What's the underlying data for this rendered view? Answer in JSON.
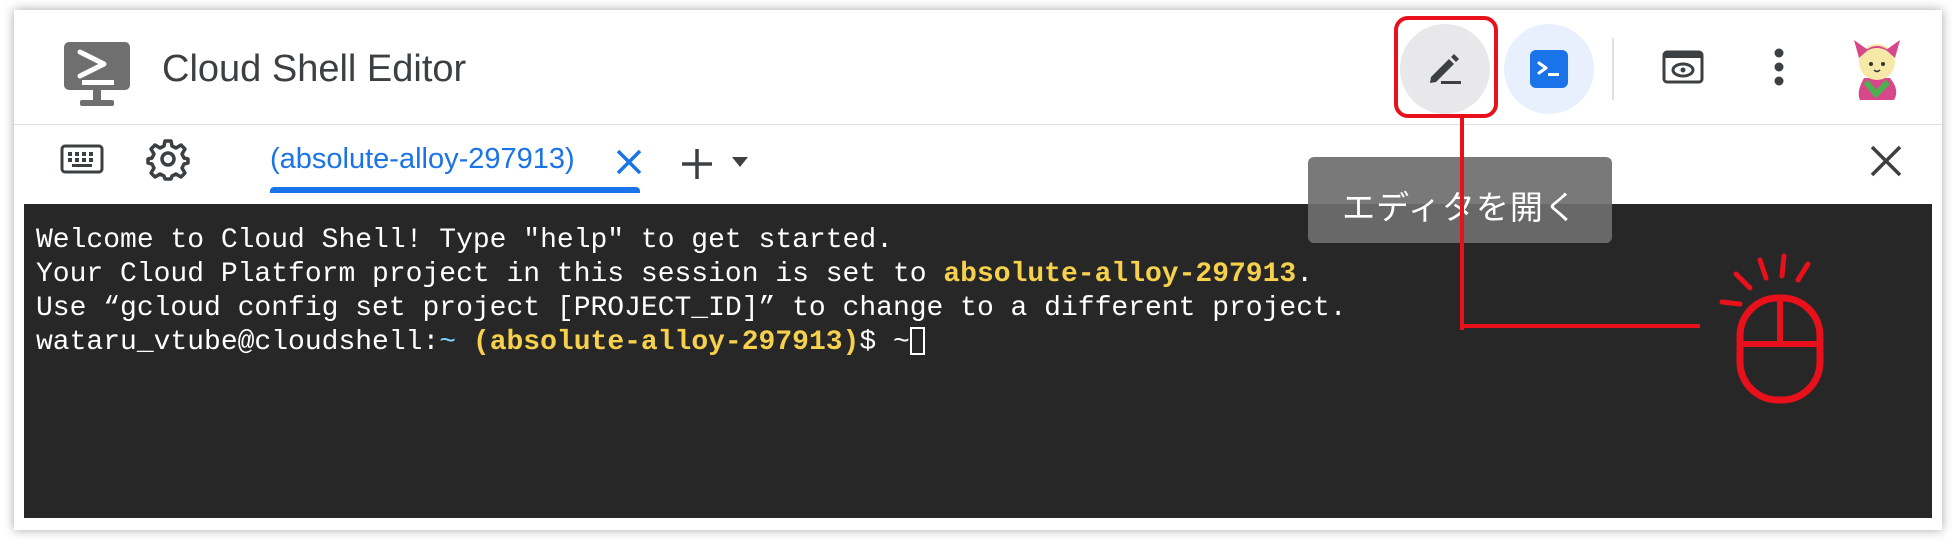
{
  "header": {
    "app_title": "Cloud Shell Editor",
    "logo_icon": "cloud-shell-terminal-icon",
    "buttons": {
      "open_editor_icon": "pencil-icon",
      "terminal_icon": "terminal-icon",
      "web_preview_icon": "web-preview-icon",
      "more_icon": "more-vert-icon",
      "avatar_icon": "user-avatar"
    }
  },
  "tooltip": {
    "text": "エディタを開く"
  },
  "tabbar": {
    "keyboard_icon": "keyboard-icon",
    "settings_icon": "gear-icon",
    "active_tab": {
      "label": "(absolute-alloy-297913)",
      "close_icon": "close-icon"
    },
    "add_tab_icon": "plus-icon",
    "dropdown_icon": "caret-down-icon",
    "close_panel_icon": "close-icon"
  },
  "terminal": {
    "line1": "Welcome to Cloud Shell! Type \"help\" to get started.",
    "line2_prefix": "Your Cloud Platform project in this session is set to ",
    "line2_project": "absolute-alloy-297913",
    "line2_suffix": ".",
    "line3": "Use “gcloud config set project [PROJECT_ID]” to change to a different project.",
    "prompt_user": "wataru_vtube@cloudshell:",
    "prompt_tilde": "~",
    "prompt_project": "(absolute-alloy-297913)",
    "prompt_symbol": "$ ~"
  },
  "colors": {
    "accent_blue": "#1a73e8",
    "terminal_bg": "#272727",
    "terminal_yellow": "#f7d14c",
    "terminal_cyan": "#7fd7ff",
    "annotation_red": "#e8101a"
  }
}
